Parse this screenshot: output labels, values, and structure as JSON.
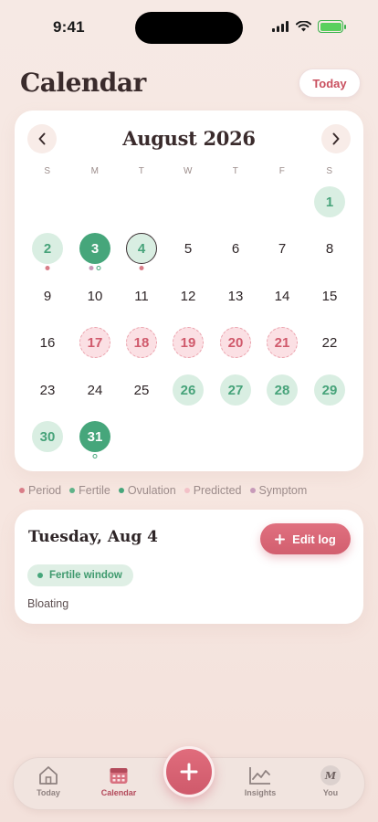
{
  "status_bar": {
    "time": "9:41"
  },
  "header": {
    "title": "Calendar",
    "today_label": "Today"
  },
  "calendar": {
    "month_title": "August 2026",
    "weekdays": [
      "S",
      "M",
      "T",
      "W",
      "T",
      "F",
      "S"
    ],
    "days": [
      {
        "d": "1",
        "state": "fertile"
      },
      {
        "d": "2",
        "state": "fertile",
        "markers": [
          "period"
        ]
      },
      {
        "d": "3",
        "state": "ovulation",
        "markers": [
          "symptom",
          "ovulation"
        ]
      },
      {
        "d": "4",
        "state": "fertile selected",
        "markers": [
          "period"
        ]
      },
      {
        "d": "5",
        "state": ""
      },
      {
        "d": "6",
        "state": ""
      },
      {
        "d": "7",
        "state": ""
      },
      {
        "d": "8",
        "state": ""
      },
      {
        "d": "9",
        "state": ""
      },
      {
        "d": "10",
        "state": ""
      },
      {
        "d": "11",
        "state": ""
      },
      {
        "d": "12",
        "state": ""
      },
      {
        "d": "13",
        "state": ""
      },
      {
        "d": "14",
        "state": ""
      },
      {
        "d": "15",
        "state": ""
      },
      {
        "d": "16",
        "state": ""
      },
      {
        "d": "17",
        "state": "predicted"
      },
      {
        "d": "18",
        "state": "predicted"
      },
      {
        "d": "19",
        "state": "predicted"
      },
      {
        "d": "20",
        "state": "predicted"
      },
      {
        "d": "21",
        "state": "predicted"
      },
      {
        "d": "22",
        "state": ""
      },
      {
        "d": "23",
        "state": ""
      },
      {
        "d": "24",
        "state": ""
      },
      {
        "d": "25",
        "state": ""
      },
      {
        "d": "26",
        "state": "fertile"
      },
      {
        "d": "27",
        "state": "fertile"
      },
      {
        "d": "28",
        "state": "fertile"
      },
      {
        "d": "29",
        "state": "fertile"
      },
      {
        "d": "30",
        "state": "fertile"
      },
      {
        "d": "31",
        "state": "ovulation",
        "markers": [
          "ovulation"
        ]
      }
    ]
  },
  "legend": [
    {
      "label": "Period",
      "color": "#d97d88"
    },
    {
      "label": "Fertile",
      "color": "#5fb389"
    },
    {
      "label": "Ovulation",
      "color": "#46a67b"
    },
    {
      "label": "Predicted",
      "color": "#f3c1c8"
    },
    {
      "label": "Symptom",
      "color": "#c79ab9"
    }
  ],
  "day_detail": {
    "title": "Tuesday, Aug 4",
    "edit_label": "Edit log",
    "chip_label": "Fertile window",
    "symptom": "Bloating"
  },
  "tab_bar": {
    "tabs": [
      {
        "label": "Today",
        "icon": "home-icon"
      },
      {
        "label": "Calendar",
        "icon": "calendar-icon",
        "active": true
      },
      {
        "label": "Insights",
        "icon": "chart-icon"
      },
      {
        "label": "You",
        "icon": "avatar",
        "avatar_letter": "M"
      }
    ],
    "fab_icon": "plus-icon"
  }
}
